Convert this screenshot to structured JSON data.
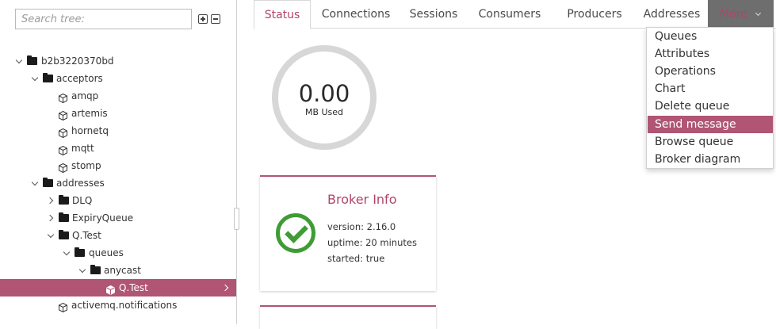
{
  "sidebar": {
    "search_placeholder": "Search tree:",
    "tree": [
      {
        "label": "b2b3220370bd",
        "type": "folder",
        "toggle": "down"
      },
      {
        "label": "acceptors",
        "type": "folder",
        "toggle": "down"
      },
      {
        "label": "amqp",
        "type": "cube"
      },
      {
        "label": "artemis",
        "type": "cube"
      },
      {
        "label": "hornetq",
        "type": "cube"
      },
      {
        "label": "mqtt",
        "type": "cube"
      },
      {
        "label": "stomp",
        "type": "cube"
      },
      {
        "label": "addresses",
        "type": "folder",
        "toggle": "down"
      },
      {
        "label": "DLQ",
        "type": "folder",
        "toggle": "right"
      },
      {
        "label": "ExpiryQueue",
        "type": "folder",
        "toggle": "right"
      },
      {
        "label": "Q.Test",
        "type": "folder",
        "toggle": "down"
      },
      {
        "label": "queues",
        "type": "folder",
        "toggle": "down"
      },
      {
        "label": "anycast",
        "type": "folder",
        "toggle": "down"
      },
      {
        "label": "Q.Test",
        "type": "cube",
        "selected": true
      },
      {
        "label": "activemq.notifications",
        "type": "cube"
      }
    ]
  },
  "tabs": [
    {
      "label": "Status",
      "active": true
    },
    {
      "label": "Connections"
    },
    {
      "label": "Sessions"
    },
    {
      "label": "Consumers"
    },
    {
      "label": "Producers"
    },
    {
      "label": "Addresses"
    },
    {
      "label": "More"
    }
  ],
  "more_menu": {
    "items": [
      {
        "label": "Queues"
      },
      {
        "label": "Attributes"
      },
      {
        "label": "Operations"
      },
      {
        "label": "Chart"
      },
      {
        "label": "Delete queue"
      },
      {
        "label": "Send message",
        "active": true
      },
      {
        "label": "Browse queue"
      },
      {
        "label": "Broker diagram"
      }
    ]
  },
  "gauge": {
    "value": "0.00",
    "label": "MB Used",
    "level_fraction": 0.0
  },
  "broker_info": {
    "title": "Broker Info",
    "status_icon": "check-circle-icon",
    "version": "version: 2.16.0",
    "uptime": "uptime: 20 minutes",
    "started": "started: true"
  },
  "colors": {
    "accent": "#b05573",
    "accent_text": "#b0446b",
    "success": "#3f9c35",
    "more_tab_bg": "#6e6e6e",
    "gauge_track": "#d7d7d7"
  }
}
